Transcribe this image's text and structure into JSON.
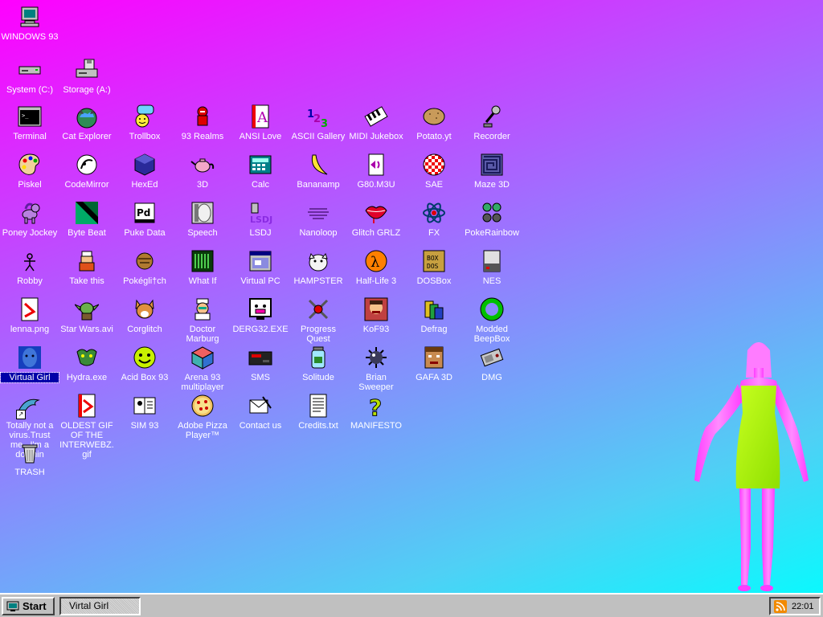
{
  "desktop": {
    "icons": [
      {
        "label": "WINDOWS 93",
        "icon": "computer-icon"
      },
      {
        "label": "System (C:)",
        "icon": "drive-icon"
      },
      {
        "label": "Storage (A:)",
        "icon": "floppy-drive-icon"
      },
      {
        "label": "Terminal",
        "icon": "terminal-icon"
      },
      {
        "label": "Cat Explorer",
        "icon": "cat-globe-icon"
      },
      {
        "label": "Trollbox",
        "icon": "chat-smiley-icon"
      },
      {
        "label": "93 Realms",
        "icon": "knight-icon"
      },
      {
        "label": "ANSI Love",
        "icon": "ansi-a-icon"
      },
      {
        "label": "ASCII Gallery",
        "icon": "ascii-123-icon"
      },
      {
        "label": "MIDI Jukebox",
        "icon": "piano-keys-icon"
      },
      {
        "label": "Potato.yt",
        "icon": "potato-icon"
      },
      {
        "label": "Recorder",
        "icon": "microphone-icon"
      },
      {
        "label": "Piskel",
        "icon": "palette-icon"
      },
      {
        "label": "CodeMirror",
        "icon": "code-mirror-icon"
      },
      {
        "label": "HexEd",
        "icon": "hex-cube-icon"
      },
      {
        "label": "3D",
        "icon": "teapot-icon"
      },
      {
        "label": "Calc",
        "icon": "calculator-icon"
      },
      {
        "label": "Bananamp",
        "icon": "banana-icon"
      },
      {
        "label": "G80.M3U",
        "icon": "playlist-icon"
      },
      {
        "label": "SAE",
        "icon": "amiga-ball-icon"
      },
      {
        "label": "Maze 3D",
        "icon": "maze-icon"
      },
      {
        "label": "Poney Jockey",
        "icon": "pony-icon"
      },
      {
        "label": "Byte Beat",
        "icon": "bytebeat-icon"
      },
      {
        "label": "Puke Data",
        "icon": "pd-icon"
      },
      {
        "label": "Speech",
        "icon": "speech-face-icon"
      },
      {
        "label": "LSDJ",
        "icon": "lsdj-icon"
      },
      {
        "label": "Nanoloop",
        "icon": "nanoloop-icon"
      },
      {
        "label": "Glitch GRLZ",
        "icon": "lips-icon"
      },
      {
        "label": "FX",
        "icon": "atom-icon"
      },
      {
        "label": "PokeRainbow",
        "icon": "pokemon-icon"
      },
      {
        "label": "Robby",
        "icon": "stick-figure-icon"
      },
      {
        "label": "Take this",
        "icon": "pixel-character-icon"
      },
      {
        "label": "Pokégli†ch",
        "icon": "glitch-ball-icon"
      },
      {
        "label": "What If",
        "icon": "what-if-icon"
      },
      {
        "label": "Virtual PC",
        "icon": "window-icon"
      },
      {
        "label": "HAMPSTER",
        "icon": "hamster-icon"
      },
      {
        "label": "Half-Life 3",
        "icon": "lambda-icon"
      },
      {
        "label": "DOSBox",
        "icon": "dosbox-icon"
      },
      {
        "label": "NES",
        "icon": "nes-icon"
      },
      {
        "label": "lenna.png",
        "icon": "image-file-icon"
      },
      {
        "label": "Star Wars.avi",
        "icon": "yoda-icon"
      },
      {
        "label": "Corglitch",
        "icon": "corgi-icon"
      },
      {
        "label": "Doctor Marburg",
        "icon": "doctor-icon"
      },
      {
        "label": "DERG32.EXE",
        "icon": "derg-monitor-icon"
      },
      {
        "label": "Progress Quest",
        "icon": "crossed-swords-icon"
      },
      {
        "label": "KoF93",
        "icon": "fighter-icon"
      },
      {
        "label": "Defrag",
        "icon": "defrag-icon"
      },
      {
        "label": "Modded BeepBox",
        "icon": "green-ring-icon"
      },
      {
        "label": "Virtual Girl",
        "icon": "blue-face-icon"
      },
      {
        "label": "Hydra.exe",
        "icon": "hydra-icon"
      },
      {
        "label": "Acid Box 93",
        "icon": "acid-smiley-icon"
      },
      {
        "label": "Arena 93 multiplayer",
        "icon": "cube-icon"
      },
      {
        "label": "SMS",
        "icon": "sega-console-icon"
      },
      {
        "label": "Solitude",
        "icon": "jar-icon"
      },
      {
        "label": "Brian Sweeper",
        "icon": "mine-icon"
      },
      {
        "label": "GAFA 3D",
        "icon": "doom-face-icon"
      },
      {
        "label": "DMG",
        "icon": "gameboy-icon"
      },
      {
        "label": "Totally not a virus.Trust me...I'm a dolphin",
        "icon": "dolphin-icon"
      },
      {
        "label": "OLDEST GIF OF THE INTERWEBZ.gif",
        "icon": "gif-file-icon"
      },
      {
        "label": "SIM 93",
        "icon": "sim-icon"
      },
      {
        "label": "Adobe Pizza Player™",
        "icon": "pizza-icon"
      },
      {
        "label": "Contact us",
        "icon": "contact-icon"
      },
      {
        "label": "Credits.txt",
        "icon": "text-file-icon"
      },
      {
        "label": "MANIFESTO",
        "icon": "question-mark-icon"
      },
      {
        "label": "TRASH",
        "icon": "trash-icon"
      }
    ]
  },
  "taskbar": {
    "start_label": "Start",
    "task_label": "Virtal Girl",
    "clock": "22:01"
  },
  "colors": {
    "bg_top": "#ff00ff",
    "bg_bottom": "#00ffff",
    "taskbar": "#c0c0c0",
    "selection": "#0000a8"
  }
}
